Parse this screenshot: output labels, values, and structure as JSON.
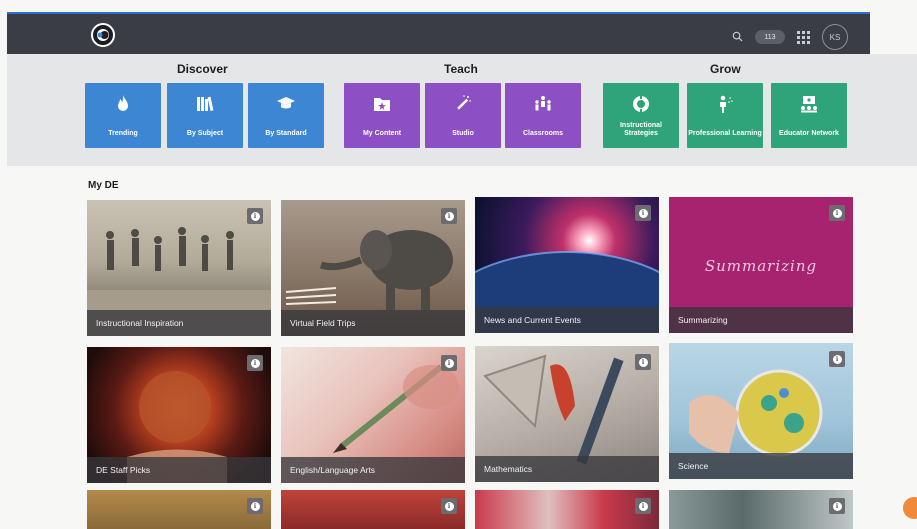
{
  "header": {
    "counter_pill": "113",
    "user_initials": "KS"
  },
  "nav": {
    "groups": [
      {
        "title": "Discover"
      },
      {
        "title": "Teach"
      },
      {
        "title": "Grow"
      }
    ],
    "tiles": [
      {
        "label": "Trending",
        "icon": "flame-icon",
        "color": "#3d86d4"
      },
      {
        "label": "By Subject",
        "icon": "books-icon",
        "color": "#3d86d4"
      },
      {
        "label": "By Standard",
        "icon": "graduation-cap-icon",
        "color": "#3d86d4"
      },
      {
        "label": "My Content",
        "icon": "star-folder-icon",
        "color": "#8c4fc4"
      },
      {
        "label": "Studio",
        "icon": "magic-wand-icon",
        "color": "#8c4fc4"
      },
      {
        "label": "Classrooms",
        "icon": "people-icon",
        "color": "#8c4fc4"
      },
      {
        "label": "Instructional Strategies",
        "icon": "lifebuoy-icon",
        "color": "#2fa37a"
      },
      {
        "label": "Professional Learning",
        "icon": "presenter-icon",
        "color": "#2fa37a"
      },
      {
        "label": "Educator Network",
        "icon": "network-icon",
        "color": "#2fa37a"
      }
    ]
  },
  "my_de": {
    "title": "My DE",
    "cards": [
      {
        "label": "Instructional Inspiration"
      },
      {
        "label": "Virtual Field Trips"
      },
      {
        "label": "News and Current Events"
      },
      {
        "label": "Summarizing",
        "overlay_text": "Summarizing"
      },
      {
        "label": "DE Staff Picks"
      },
      {
        "label": "English/Language Arts"
      },
      {
        "label": "Mathematics"
      },
      {
        "label": "Science"
      }
    ]
  },
  "colors": {
    "topbar": "#3a3d44",
    "discover": "#3d86d4",
    "teach": "#8c4fc4",
    "grow": "#2fa37a"
  }
}
